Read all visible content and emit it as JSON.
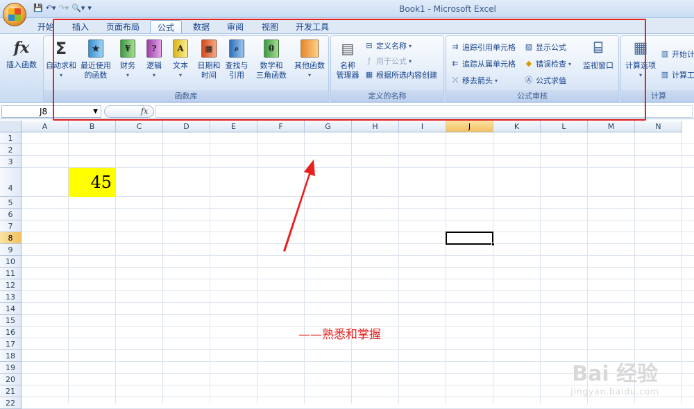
{
  "window": {
    "title": "Book1 - Microsoft Excel"
  },
  "tabs": [
    "开始",
    "插入",
    "页面布局",
    "公式",
    "数据",
    "审阅",
    "视图",
    "开发工具"
  ],
  "active_tab": "公式",
  "ribbon": {
    "insert_function": "插入函数",
    "autosum": "自动求和",
    "recent": "最近使用\n的函数",
    "financial": "财务",
    "logical": "逻辑",
    "text": "文本",
    "datetime": "日期和\n时间",
    "lookup": "查找与\n引用",
    "math": "数学和\n三角函数",
    "other": "其他函数",
    "group_library": "函数库",
    "name_manager": "名称\n管理器",
    "define_name": "定义名称",
    "use_in_formula": "用于公式",
    "create_from_selection": "根据所选内容创建",
    "group_names": "定义的名称",
    "trace_precedents": "追踪引用单元格",
    "trace_dependents": "追踪从属单元格",
    "remove_arrows": "移去箭头",
    "show_formulas": "显示公式",
    "error_checking": "错误检查",
    "evaluate_formula": "公式求值",
    "watch_window": "监视窗口",
    "group_auditing": "公式审核",
    "calc_options": "计算选项",
    "calc_now": "开始计",
    "calc_sheet": "计算工",
    "group_calc": "计算"
  },
  "formula_bar": {
    "name_box": "J8",
    "fx": "fx",
    "value": ""
  },
  "sheet": {
    "columns": [
      "A",
      "B",
      "C",
      "D",
      "E",
      "F",
      "G",
      "H",
      "I",
      "J",
      "K",
      "L",
      "M",
      "N"
    ],
    "rows": [
      "1",
      "2",
      "3",
      "4",
      "5",
      "6",
      "7",
      "8",
      "9",
      "10",
      "11",
      "12",
      "13",
      "14",
      "15",
      "16",
      "17",
      "18",
      "19",
      "20",
      "21",
      "22"
    ],
    "selected_cell": "J8",
    "cell_B4": "45",
    "cell_B4_fill": "#ffff00"
  },
  "annotation": {
    "text": "——熟悉和掌握",
    "color": "#e8211d"
  },
  "watermark": {
    "brand": "Bai 经验",
    "url": "jingyan.baidu.com"
  }
}
